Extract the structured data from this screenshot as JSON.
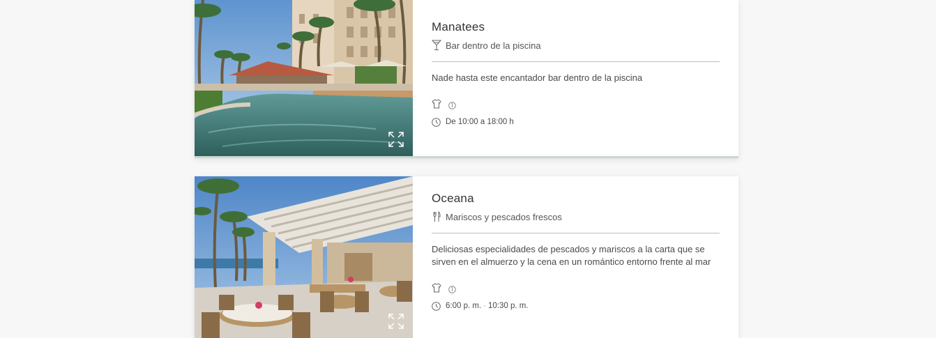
{
  "colors": {
    "background": "#f7f7f7",
    "card": "#ffffff",
    "accent_border": "#c9d9cf",
    "rule": "#bdbdbd",
    "text": "#3b3b3b"
  },
  "venues": [
    {
      "name": "Manatees",
      "type_icon": "cocktail-glass-icon",
      "type": "Bar dentro de la piscina",
      "description": "Nade hasta este encantador bar dentro de la piscina",
      "dress_icon": "shirt-icon",
      "info_icon": "info-icon",
      "hours_icon": "clock-icon",
      "hours": "De 10:00 a 18:00 h",
      "expand_icon": "expand-icon"
    },
    {
      "name": "Oceana",
      "type_icon": "fork-knife-icon",
      "type": "Mariscos y pescados frescos",
      "description": "Deliciosas especialidades de pescados y mariscos a la carta que se sirven en el almuerzo y la cena en un romántico entorno frente al mar",
      "dress_icon": "shirt-icon",
      "info_icon": "info-icon",
      "hours_icon": "clock-icon",
      "hours_open": "6:00 p. m.",
      "hours_separator": "-",
      "hours_close": "10:30 p. m.",
      "expand_icon": "expand-icon"
    }
  ]
}
